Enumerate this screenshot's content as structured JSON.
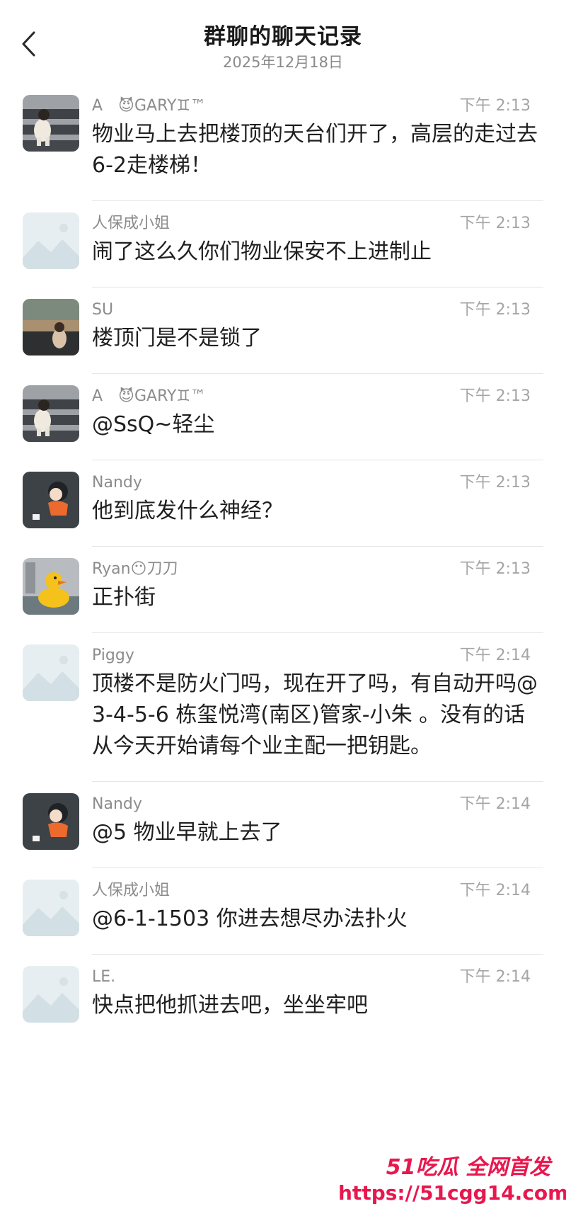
{
  "header": {
    "title": "群聊的聊天记录",
    "date": "2025年12月18日"
  },
  "messages": [
    {
      "name": "A　😈GARY♊™",
      "time": "下午 2:13",
      "text": "物业马上去把楼顶的天台们开了，高层的走过去6-2走楼梯！",
      "avatar": "photo-child-avatar"
    },
    {
      "name": "人保成小姐",
      "time": "下午 2:13",
      "text": "闹了这么久你们物业保安不上进制止",
      "avatar": "placeholder-avatar"
    },
    {
      "name": "SU",
      "time": "下午 2:13",
      "text": "楼顶门是不是锁了",
      "avatar": "photo-scenery-avatar"
    },
    {
      "name": "A　😈GARY♊™",
      "time": "下午 2:13",
      "text": "@SsQ~轻尘",
      "avatar": "photo-child-avatar"
    },
    {
      "name": "Nandy",
      "time": "下午 2:13",
      "text": "他到底发什么神经？",
      "avatar": "cartoon-girl-avatar"
    },
    {
      "name": "Ryan😶刀刀",
      "time": "下午 2:13",
      "text": "正扑街",
      "avatar": "rubber-duck-avatar"
    },
    {
      "name": "Piggy",
      "time": "下午 2:14",
      "text": "顶楼不是防火门吗，现在开了吗，有自动开吗@3-4-5-6 栋玺悦湾(南区)管家-小朱 。没有的话从今天开始请每个业主配一把钥匙。",
      "avatar": "placeholder-avatar"
    },
    {
      "name": "Nandy",
      "time": "下午 2:14",
      "text": "@5 物业早就上去了",
      "avatar": "cartoon-girl-avatar"
    },
    {
      "name": "人保成小姐",
      "time": "下午 2:14",
      "text": "@6-1-1503 你进去想尽办法扑火",
      "avatar": "placeholder-avatar"
    },
    {
      "name": "LE.",
      "time": "下午 2:14",
      "text": "快点把他抓进去吧，坐坐牢吧",
      "avatar": "placeholder-avatar"
    }
  ],
  "watermark": {
    "line1": "51吃瓜 全网首发",
    "line2": "https://51cgg14.com"
  },
  "colors": {
    "watermark": "#e8174e",
    "meta": "#8c8c8c",
    "text": "#1f1f1f"
  }
}
